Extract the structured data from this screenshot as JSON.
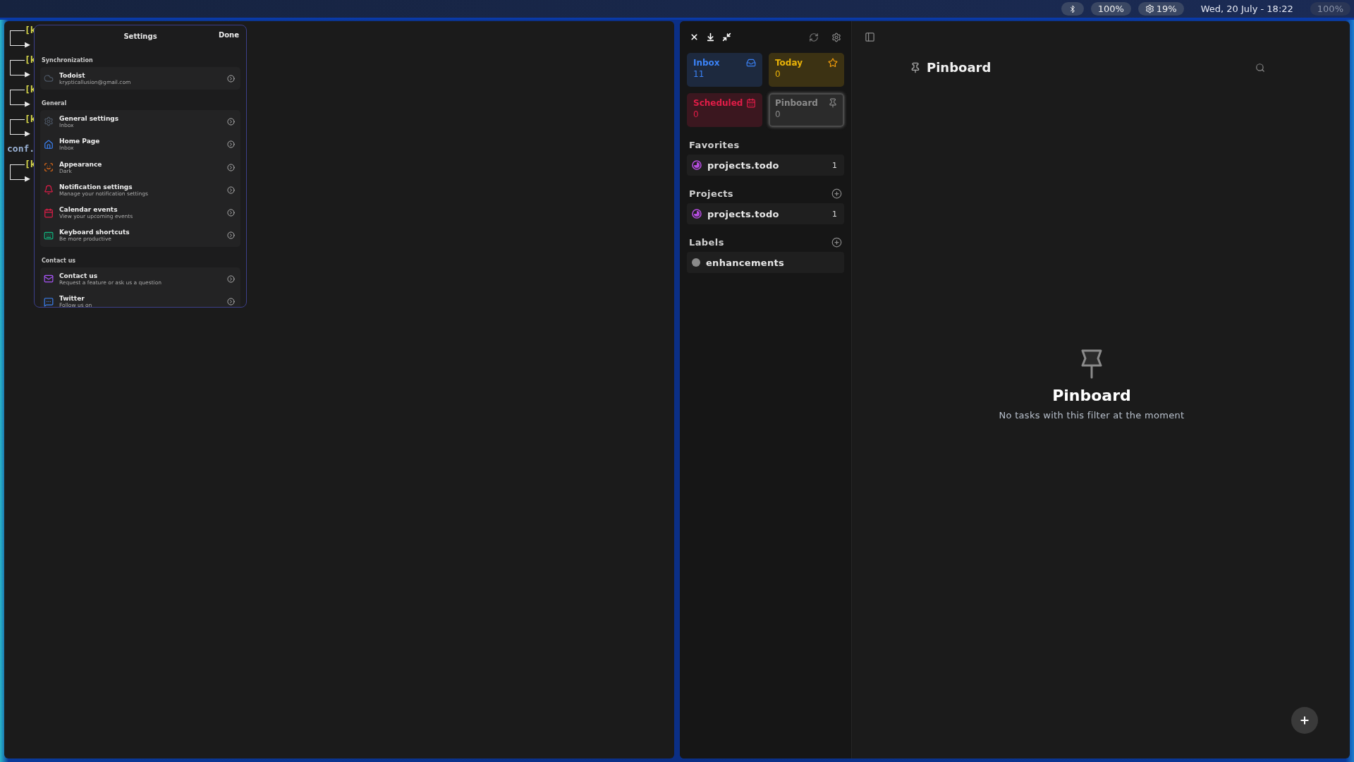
{
  "top_bar": {
    "status": [
      {
        "kind": "bluetooth"
      },
      {
        "kind": "pill",
        "text": "100%"
      },
      {
        "kind": "gear",
        "text": "19%"
      },
      {
        "kind": "clock",
        "text": "Wed, 20 July - 18:22"
      },
      {
        "kind": "dim",
        "text": "100%"
      }
    ]
  },
  "terminal": {
    "lines": [
      {
        "kind": "branch",
        "text": "[k",
        "arrow": "▶"
      },
      {
        "kind": "branch",
        "text": "[k",
        "arrow": "▶"
      },
      {
        "kind": "branch",
        "text": "[k",
        "arrow": "▶"
      },
      {
        "kind": "branch",
        "text": "[k",
        "arrow": "▶"
      },
      {
        "kind": "plain",
        "text": "conf."
      },
      {
        "kind": "branch",
        "text": "[k",
        "arrow": "▶"
      }
    ]
  },
  "settings": {
    "title": "Settings",
    "done": "Done",
    "sections": [
      {
        "title": "Synchronization",
        "items": [
          {
            "title": "Todoist",
            "subtitle": "krypticallusion@gmail.com"
          }
        ]
      },
      {
        "title": "General",
        "items": [
          {
            "title": "General settings",
            "subtitle": "Inbox"
          },
          {
            "title": "Home Page",
            "subtitle": "Inbox"
          },
          {
            "title": "Appearance",
            "subtitle": "Dark"
          },
          {
            "title": "Notification settings",
            "subtitle": "Manage your notification settings"
          },
          {
            "title": "Calendar events",
            "subtitle": "View your upcoming events"
          },
          {
            "title": "Keyboard shortcuts",
            "subtitle": "Be more productive"
          }
        ]
      },
      {
        "title": "Contact us",
        "items": [
          {
            "title": "Contact us",
            "subtitle": "Request a feature or ask us a question"
          },
          {
            "title": "Twitter",
            "subtitle": "Follow us on"
          }
        ]
      }
    ]
  },
  "sidebar": {
    "cards": [
      {
        "label": "Inbox",
        "count": "11",
        "color": "#3b82f6",
        "selected": false
      },
      {
        "label": "Today",
        "count": "0",
        "color": "#eab308",
        "selected": false
      },
      {
        "label": "Scheduled",
        "count": "0",
        "color": "#e11d48",
        "selected": false
      },
      {
        "label": "Pinboard",
        "count": "0",
        "color": "#8a8a8a",
        "selected": true
      }
    ],
    "sections": [
      {
        "title": "Favorites",
        "addable": false,
        "items": [
          {
            "kind": "project",
            "name": "projects.todo",
            "count": "1",
            "color": "#b44dde"
          }
        ]
      },
      {
        "title": "Projects",
        "addable": true,
        "items": [
          {
            "kind": "project",
            "name": "projects.todo",
            "count": "1",
            "color": "#b44dde"
          }
        ]
      },
      {
        "title": "Labels",
        "addable": true,
        "items": [
          {
            "kind": "label",
            "name": "enhancements",
            "color": "#8a8a8a"
          }
        ]
      }
    ]
  },
  "main": {
    "title": "Pinboard",
    "empty_title": "Pinboard",
    "empty_message": "No tasks with this filter at the moment"
  }
}
